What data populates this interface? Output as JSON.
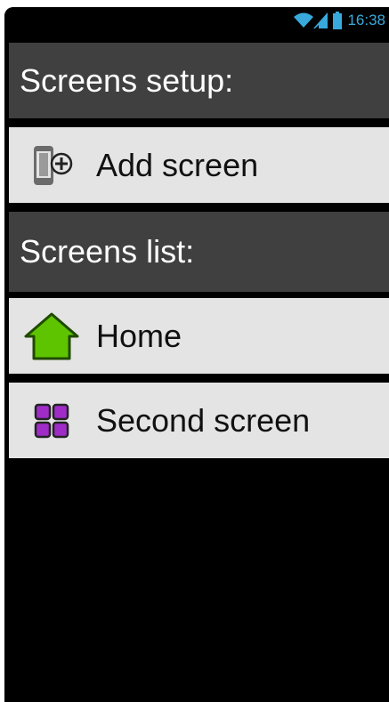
{
  "status_bar": {
    "time": "16:38",
    "wifi_icon": "wifi-icon",
    "signal_icon": "signal-icon",
    "battery_icon": "battery-icon",
    "accent_color": "#39a9dc"
  },
  "setup_section": {
    "header": "Screens setup:",
    "items": [
      {
        "label": "Add screen",
        "icon": "add-screen-icon"
      }
    ]
  },
  "list_section": {
    "header": "Screens list:",
    "items": [
      {
        "label": "Home",
        "icon": "home-icon",
        "icon_color": "#5fc400"
      },
      {
        "label": "Second screen",
        "icon": "grid-icon",
        "icon_color": "#a02cc8"
      }
    ]
  }
}
